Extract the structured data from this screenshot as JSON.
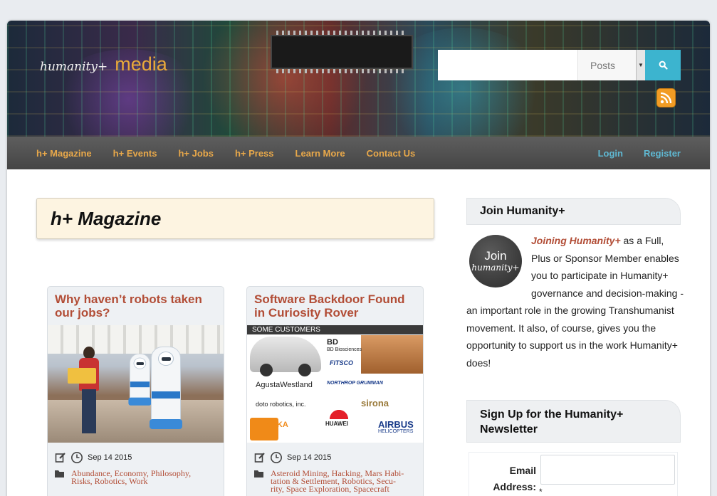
{
  "header": {
    "logo_humanity": "humanity+",
    "logo_media": "media",
    "search": {
      "placeholder": "",
      "scope": "Posts"
    }
  },
  "nav": {
    "left": [
      "h+ Magazine",
      "h+ Events",
      "h+ Jobs",
      "h+ Press",
      "Learn More",
      "Contact Us"
    ],
    "right": [
      "Login",
      "Register"
    ]
  },
  "main": {
    "title": "h+ Magazine",
    "posts": [
      {
        "title": "Why haven’t robots taken our jobs?",
        "date": "Sep 14 2015",
        "categories": "Abundance, Economy, Philosophy, Risks, Robotics, Work"
      },
      {
        "title": "Software Backdoor Found in Curiosity Rover",
        "date": "Sep 14 2015",
        "categories": "Asteroid Mining, Hacking, Mars Habi-tation & Settlement, Robotics, Secu-rity, Space Exploration, Spacecraft",
        "image": {
          "banner": "SOME CUSTOMERS",
          "logos": [
            "BD",
            "BD Biosciences",
            "FITSCO",
            "AgustaWestland",
            "NORTHROP GRUMMAN",
            "sirona",
            "doto robotics, inc.",
            "KUKA",
            "HUAWEI",
            "AIRBUS",
            "HELICOPTERS"
          ]
        }
      }
    ]
  },
  "sidebar": {
    "join": {
      "heading": "Join Humanity+",
      "avatar_line1": "Join",
      "avatar_line2": "humanity+",
      "link_text": "Joining Humanity+",
      "body": " as a Full, Plus or Sponsor Member enables you to participate in Humanity+ governance and decision-making - an important role in the growing Transhumanist movement. It also, of course, gives you the opportunity to support us in the work Humanity+ does!"
    },
    "newsletter": {
      "heading": "Sign Up for the Humanity+ Newsletter",
      "email_label": "Email Address:",
      "required_mark": "*"
    }
  },
  "colors": {
    "accent_orange": "#e8a84a",
    "link_blue": "#5fb8d2",
    "post_title_red": "#b24d36",
    "search_button": "#3cb4cf",
    "rss": "#f29c24"
  }
}
